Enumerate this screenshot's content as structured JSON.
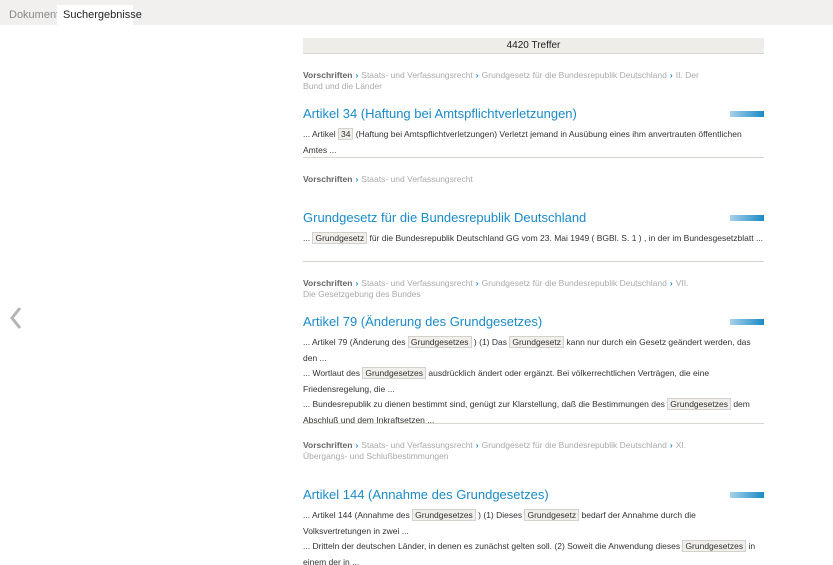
{
  "tabs": [
    {
      "label": "Dokument"
    },
    {
      "label": "Suchergebnisse"
    }
  ],
  "hits_label": "4420 Treffer",
  "results": [
    {
      "crumbs": [
        "Vorschriften",
        "Staats- und Verfassungsrecht",
        "Grundgesetz für die Bundesrepublik Deutschland",
        "II. Der Bund und die Länder"
      ],
      "title": "Artikel 34 (Haftung bei Amtspflichtverletzungen)",
      "snippet": [
        [
          [
            "... Artikel ",
            false
          ],
          [
            "34",
            true
          ],
          [
            " (Haftung bei Amtspflichtverletzungen) Verletzt jemand in Ausübung eines ihm anvertrauten öffentlichen Amtes ...",
            false
          ]
        ]
      ]
    },
    {
      "crumbs": [
        "Vorschriften",
        "Staats- und Verfassungsrecht"
      ],
      "title": "Grundgesetz für die Bundesrepublik Deutschland",
      "snippet": [
        [
          [
            "... ",
            false
          ],
          [
            "Grundgesetz",
            true
          ],
          [
            " für die Bundesrepublik Deutschland GG vom 23. Mai 1949 ( BGBl. S. 1 ) , in der im Bundesgesetzblatt ...",
            false
          ]
        ]
      ]
    },
    {
      "crumbs": [
        "Vorschriften",
        "Staats- und Verfassungsrecht",
        "Grundgesetz für die Bundesrepublik Deutschland",
        "VII. Die Gesetzgebung des Bundes"
      ],
      "title": "Artikel 79 (Änderung des Grundgesetzes)",
      "snippet": [
        [
          [
            "... Artikel 79 (Änderung des ",
            false
          ],
          [
            "Grundgesetzes",
            true
          ],
          [
            " ) (1) Das ",
            false
          ],
          [
            "Grundgesetz",
            true
          ],
          [
            " kann nur durch ein Gesetz geändert werden, das den ...",
            false
          ]
        ],
        [
          [
            "... Wortlaut des ",
            false
          ],
          [
            "Grundgesetzes",
            true
          ],
          [
            " ausdrücklich ändert oder ergänzt. Bei völkerrechtlichen Verträgen, die eine Friedensregelung, die ...",
            false
          ]
        ],
        [
          [
            "... Bundesrepublik zu dienen bestimmt sind, genügt zur Klarstellung, daß die Bestimmungen des ",
            false
          ],
          [
            "Grundgesetzes",
            true
          ],
          [
            " dem Abschluß und dem Inkraftsetzen ...",
            false
          ]
        ]
      ]
    },
    {
      "crumbs": [
        "Vorschriften",
        "Staats- und Verfassungsrecht",
        "Grundgesetz für die Bundesrepublik Deutschland",
        "XI. Übergangs- und Schlußbestimmungen"
      ],
      "title": "Artikel 144 (Annahme des Grundgesetzes)",
      "snippet": [
        [
          [
            "... Artikel 144 (Annahme des ",
            false
          ],
          [
            "Grundgesetzes",
            true
          ],
          [
            " ) (1) Dieses ",
            false
          ],
          [
            "Grundgesetz",
            true
          ],
          [
            " bedarf der Annahme durch die Volksvertretungen in zwei ...",
            false
          ]
        ],
        [
          [
            "... Dritteln der deutschen Länder, in denen es zunächst gelten soll. (2) Soweit die Anwendung dieses ",
            false
          ],
          [
            "Grundgesetzes",
            true
          ],
          [
            " in einem der in ...",
            false
          ]
        ]
      ]
    }
  ]
}
